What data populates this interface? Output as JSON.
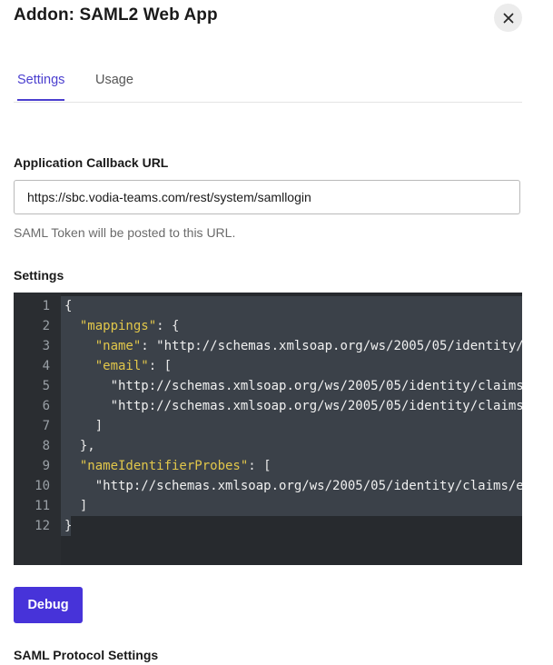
{
  "dialog": {
    "title": "Addon: SAML2 Web App"
  },
  "tabs": [
    {
      "label": "Settings",
      "active": true
    },
    {
      "label": "Usage",
      "active": false
    }
  ],
  "callback": {
    "label": "Application Callback URL",
    "value": "https://sbc.vodia-teams.com/rest/system/samllogin",
    "help": "SAML Token will be posted to this URL."
  },
  "settings": {
    "label": "Settings",
    "line_numbers": [
      "1",
      "2",
      "3",
      "4",
      "5",
      "6",
      "7",
      "8",
      "9",
      "10",
      "11",
      "12"
    ],
    "code": {
      "l1": "{",
      "l2_key": "\"mappings\"",
      "l2_rest": ": {",
      "l3_key": "\"name\"",
      "l3_rest": ": \"http://schemas.xmlsoap.org/ws/2005/05/identity/",
      "l4_key": "\"email\"",
      "l4_rest": ": [",
      "l5": "\"http://schemas.xmlsoap.org/ws/2005/05/identity/claims",
      "l6": "\"http://schemas.xmlsoap.org/ws/2005/05/identity/claims",
      "l7": "]",
      "l8": "},",
      "l9_key": "\"nameIdentifierProbes\"",
      "l9_rest": ": [",
      "l10": "\"http://schemas.xmlsoap.org/ws/2005/05/identity/claims/e",
      "l11": "]",
      "l12": "}"
    }
  },
  "debug_button": {
    "label": "Debug"
  },
  "protocol_section": {
    "label": "SAML Protocol Settings"
  },
  "colors": {
    "accent": "#4b3fcf",
    "button": "#4733d9",
    "editor_bg": "#272a2e",
    "editor_selection": "#3b4149",
    "json_key": "#e2c74a"
  },
  "icons": {
    "close": "close-icon"
  }
}
